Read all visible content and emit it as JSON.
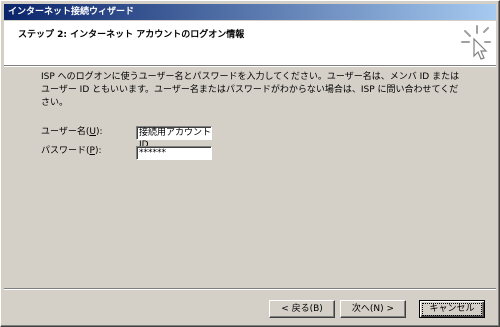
{
  "window": {
    "title": "インターネット接続ウィザード"
  },
  "header": {
    "step_title": "ステップ 2: インターネット アカウントのログオン情報",
    "icon": "wizard-sparkle-icon"
  },
  "description": "ISP へのログオンに使うユーザー名とパスワードを入力してください。ユーザー名は、メンバ ID またはユーザー ID ともいいます。ユーザー名またはパスワードがわからない場合は、ISP に問い合わせてください。",
  "form": {
    "username_label_pre": "ユーザー名(",
    "username_accel": "U",
    "username_label_post": "):",
    "username_value": "接続用アカウント ID",
    "password_label_pre": "パスワード(",
    "password_accel": "P",
    "password_label_post": "):",
    "password_value": "******"
  },
  "buttons": {
    "back": "< 戻る(B)",
    "next": "次へ(N) >",
    "cancel": "キャンセル"
  }
}
